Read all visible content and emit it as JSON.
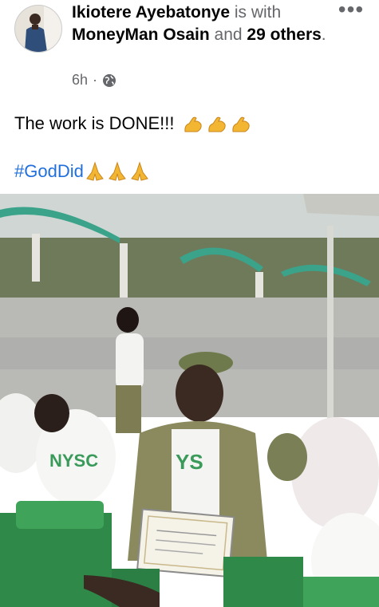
{
  "post": {
    "author": "Ikiotere Ayebatonye",
    "with_connector": " is with ",
    "tagged": "MoneyMan Osain",
    "and_connector": " and ",
    "others": "29 others",
    "period": ".",
    "time": "6h",
    "dot": "·",
    "privacy_icon": "globe-icon",
    "more_icon": "more-options-icon",
    "more_label": "•••",
    "text": "The work is DONE!!!",
    "text_emojis": [
      "flexed-biceps",
      "flexed-biceps",
      "flexed-biceps"
    ],
    "hashtag": "#GodDid",
    "hashtag_emojis": [
      "folded-hands",
      "folded-hands",
      "folded-hands"
    ]
  },
  "photo": {
    "shirt_text": "NYSC",
    "shirt_text_partial": "YS",
    "description_colors": {
      "sky": "#cfd6d3",
      "canopy": "#3aa38a",
      "ground": "#b9b9b6",
      "khaki": "#8a8a5e",
      "seat": "#2f8a4a"
    }
  },
  "colors": {
    "link": "#216fdb",
    "muted": "#65676b",
    "text": "#050505"
  }
}
